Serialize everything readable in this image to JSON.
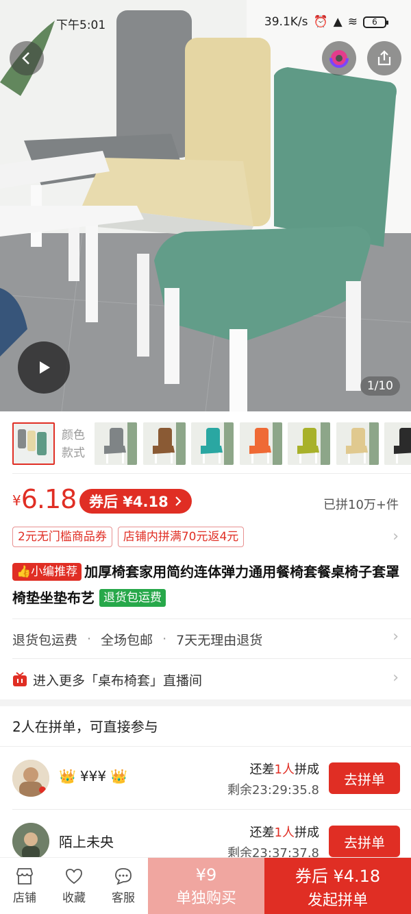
{
  "status_bar": {
    "time": "下午5:01",
    "speed": "39.1K/s",
    "battery": "6"
  },
  "hero": {
    "counter": "1/10"
  },
  "colors": {
    "accent": "#e02e24",
    "green_badge": "#27a84a",
    "chair_green": "#5f9a86",
    "chair_grey": "#85898a",
    "chair_beige": "#e6d8a6"
  },
  "icons": [
    "chevron-left-icon",
    "brand-logo-icon",
    "share-icon",
    "play-icon",
    "chevron-right-icon",
    "live-gift-icon",
    "crown-icon",
    "store-icon",
    "heart-icon",
    "chat-icon"
  ],
  "options": {
    "label_line1": "颜色",
    "label_line2": "款式",
    "swatches": [
      "#7f8486",
      "#8a5a34",
      "#2aa7a2",
      "#ef6a35",
      "#a8b12a",
      "#e0c98f",
      "#2b2b2b"
    ]
  },
  "price": {
    "yen": "¥",
    "value": "6.18",
    "coupon_label": "券后 ¥4.18",
    "sold": "已拼10万+件"
  },
  "tags": [
    "2元无门槛商品券",
    "店铺内拼满70元返4元"
  ],
  "product": {
    "recommend_badge": "小编推荐",
    "title": "加厚椅套家用简约连体弹力通用餐椅套餐桌椅子套罩椅垫坐垫布艺",
    "return_badge": "退货包运费"
  },
  "services": [
    "退货包运费",
    "全场包邮",
    "7天无理由退货"
  ],
  "service_sep": "·",
  "live": {
    "text": "进入更多「桌布椅套」直播间"
  },
  "group": {
    "heading": "2人在拼单，可直接参与",
    "items": [
      {
        "name": "¥¥¥",
        "need_prefix": "还差",
        "need_count": "1人",
        "need_suffix": "拼成",
        "remain": "剩余23:29:35.8",
        "button": "去拼单"
      },
      {
        "name": "陌上未央",
        "need_prefix": "还差",
        "need_count": "1人",
        "need_suffix": "拼成",
        "remain": "剩余23:37:37.8",
        "button": "去拼单"
      }
    ]
  },
  "bottom": {
    "store": "店铺",
    "favorite": "收藏",
    "service": "客服",
    "single_price": "¥9",
    "single_label": "单独购买",
    "group_price": "券后 ¥4.18",
    "group_label": "发起拼单"
  }
}
